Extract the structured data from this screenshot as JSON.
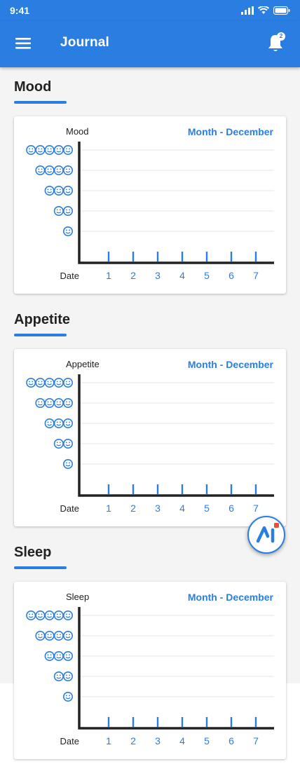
{
  "status_bar": {
    "time": "9:41"
  },
  "app_bar": {
    "title": "Journal",
    "notification_count": "2"
  },
  "colors": {
    "primary": "#2a7de1",
    "axis": "#222222",
    "grid": "#e6e6e6"
  },
  "sections": [
    {
      "title": "Mood",
      "card_label": "Mood",
      "month_label": "Month - December"
    },
    {
      "title": "Appetite",
      "card_label": "Appetite",
      "month_label": "Month - December"
    },
    {
      "title": "Sleep",
      "card_label": "Sleep",
      "month_label": "Month - December"
    }
  ],
  "chart_axis": {
    "x_label": "Date",
    "dates": [
      "1",
      "2",
      "3",
      "4",
      "5",
      "6",
      "7"
    ],
    "levels": [
      5,
      4,
      3,
      2,
      1
    ]
  },
  "fab": {
    "icon": "assistant-logo-icon"
  }
}
